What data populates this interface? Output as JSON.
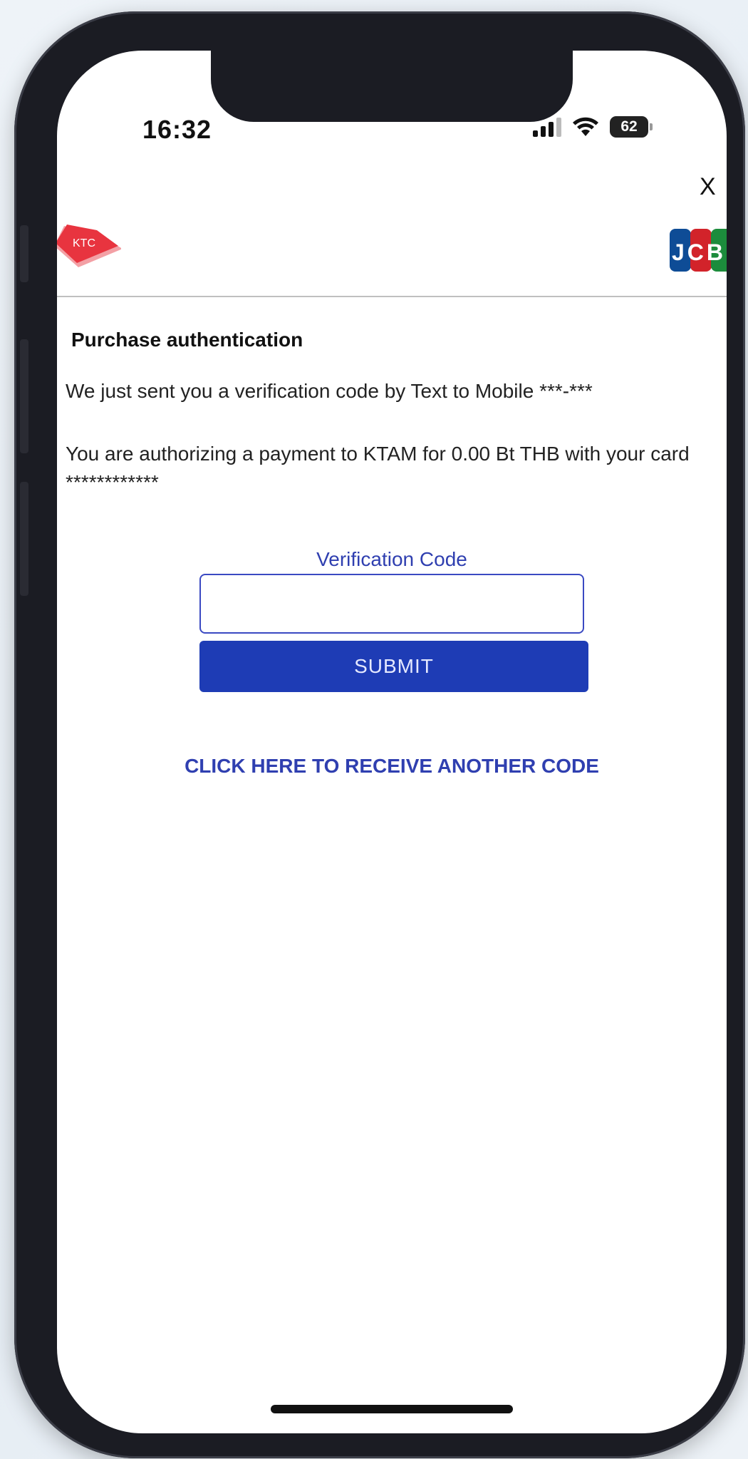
{
  "status_bar": {
    "time": "16:32",
    "battery": "62",
    "icons": [
      "cellular-signal-icon",
      "wifi-icon",
      "battery-icon"
    ]
  },
  "header": {
    "close_label": "X",
    "issuer_logo": "KTC",
    "network_logo": "JCB"
  },
  "content": {
    "title": "Purchase authentication",
    "sent_message": "We just sent you a verification code by Text to Mobile ***-***",
    "authorize_message": "You are authorizing a payment to KTAM for 0.00 Bt THB with your card ************",
    "verification_label": "Verification Code",
    "verification_value": "",
    "submit_label": "SUBMIT",
    "resend_label": "CLICK HERE TO RECEIVE ANOTHER CODE"
  },
  "colors": {
    "accent_blue": "#1e3cb5",
    "link_blue": "#2f3fb0",
    "ktc_red": "#e8343f",
    "phone_frame": "#1b1c23"
  }
}
